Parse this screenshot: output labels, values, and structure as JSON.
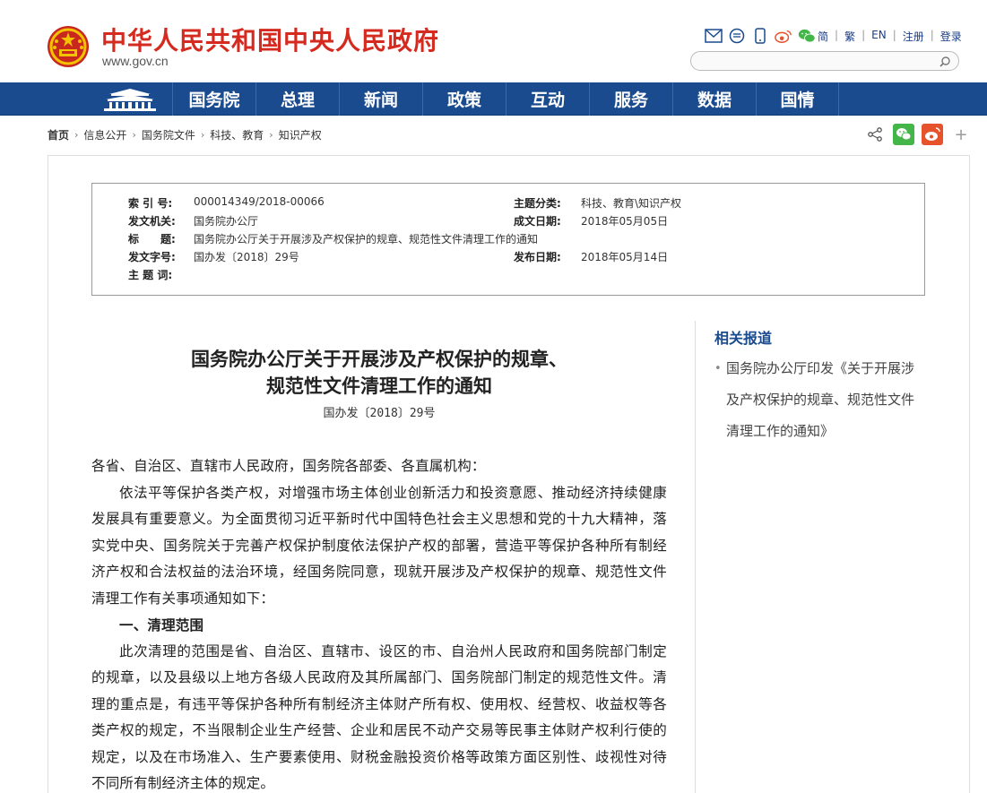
{
  "header": {
    "site_title": "中华人民共和国中央人民政府",
    "site_url": "www.gov.cn",
    "icons": [
      "mail-icon",
      "message-icon",
      "mobile-icon",
      "weibo-icon",
      "wechat-icon"
    ],
    "lang": [
      "简",
      "繁",
      "EN",
      "注册",
      "登录"
    ],
    "search_placeholder": ""
  },
  "nav": {
    "items": [
      "国务院",
      "总理",
      "新闻",
      "政策",
      "互动",
      "服务",
      "数据",
      "国情"
    ]
  },
  "breadcrumb": [
    "首页",
    "信息公开",
    "国务院文件",
    "科技、教育",
    "知识产权"
  ],
  "share": {
    "plus_label": "+"
  },
  "meta": {
    "index_label": "索 引 号:",
    "index_value": "000014349/2018-00066",
    "topic_label": "主题分类:",
    "topic_value": "科技、教育\\知识产权",
    "issuer_label": "发文机关:",
    "issuer_value": "国务院办公厅",
    "created_label": "成文日期:",
    "created_value": "2018年05月05日",
    "title_label": "标　　题:",
    "title_value": "国务院办公厅关于开展涉及产权保护的规章、规范性文件清理工作的通知",
    "docno_label": "发文字号:",
    "docno_value": "国办发〔2018〕29号",
    "published_label": "发布日期:",
    "published_value": "2018年05月14日",
    "keywords_label": "主 题 词:",
    "keywords_value": ""
  },
  "article": {
    "title_line1": "国务院办公厅关于开展涉及产权保护的规章、",
    "title_line2": "规范性文件清理工作的通知",
    "doc_number": "国办发〔2018〕29号",
    "salutation": "各省、自治区、直辖市人民政府，国务院各部委、各直属机构：",
    "para1": "依法平等保护各类产权，对增强市场主体创业创新活力和投资意愿、推动经济持续健康发展具有重要意义。为全面贯彻习近平新时代中国特色社会主义思想和党的十九大精神，落实党中央、国务院关于完善产权保护制度依法保护产权的部署，营造平等保护各种所有制经济产权和合法权益的法治环境，经国务院同意，现就开展涉及产权保护的规章、规范性文件清理工作有关事项通知如下：",
    "section1_heading": "一、清理范围",
    "para2": "此次清理的范围是省、自治区、直辖市、设区的市、自治州人民政府和国务院部门制定的规章，以及县级以上地方各级人民政府及其所属部门、国务院部门制定的规范性文件。清理的重点是，有违平等保护各种所有制经济主体财产所有权、使用权、经营权、收益权等各类产权的规定，不当限制企业生产经营、企业和居民不动产交易等民事主体财产权利行使的规定，以及在市场准入、生产要素使用、财税金融投资价格等政策方面区别性、歧视性对待不同所有制经济主体的规定。"
  },
  "sidebar": {
    "title": "相关报道",
    "items": [
      "国务院办公厅印发《关于开展涉及产权保护的规章、规范性文件清理工作的通知》"
    ]
  },
  "colors": {
    "brand_red": "#d52a1f",
    "nav_blue": "#1a4b8f",
    "wechat_green": "#44b549",
    "weibo_red": "#e6522c"
  }
}
